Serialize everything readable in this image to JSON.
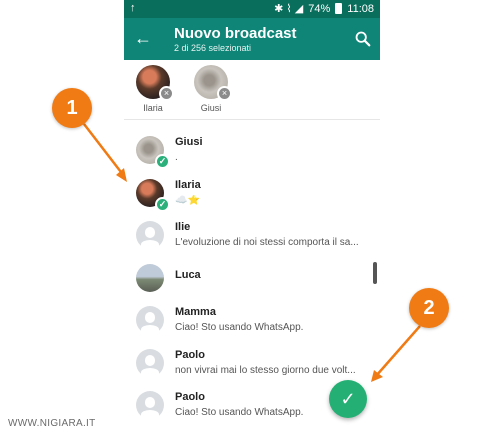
{
  "status_bar": {
    "upload_glyph": "↑",
    "signal_text": "✱  ⌇  ◢",
    "battery": "74%",
    "time": "11:08"
  },
  "app_bar": {
    "back_glyph": "←",
    "title": "Nuovo broadcast",
    "subtitle": "2 di 256 selezionati"
  },
  "selected": [
    {
      "name": "Ilaria",
      "remove_glyph": "×"
    },
    {
      "name": "Giusi",
      "remove_glyph": "×"
    }
  ],
  "contacts": [
    {
      "name": "Giusi",
      "status": ".",
      "selected": true
    },
    {
      "name": "Ilaria",
      "status": "☁️⭐",
      "selected": true
    },
    {
      "name": "Ilie",
      "status": "L'evoluzione di noi stessi comporta il sa...",
      "selected": false
    },
    {
      "name": "Luca",
      "status": "",
      "selected": false
    },
    {
      "name": "Mamma",
      "status": "Ciao! Sto usando WhatsApp.",
      "selected": false
    },
    {
      "name": "Paolo",
      "status": "non vivrai mai lo stesso giorno due volt...",
      "selected": false
    },
    {
      "name": "Paolo",
      "status": "Ciao! Sto usando WhatsApp.",
      "selected": false
    }
  ],
  "check_glyph": "✓",
  "fab_glyph": "✓",
  "annotations": {
    "badge_1": "1",
    "badge_2": "2"
  },
  "watermark": "WWW.NIGIARA.IT",
  "colors": {
    "status_bar": "#0a6e5d",
    "app_bar": "#0e8577",
    "check_badge": "#2bb07b",
    "fab": "#24b074",
    "annotation": "#f07a13"
  }
}
